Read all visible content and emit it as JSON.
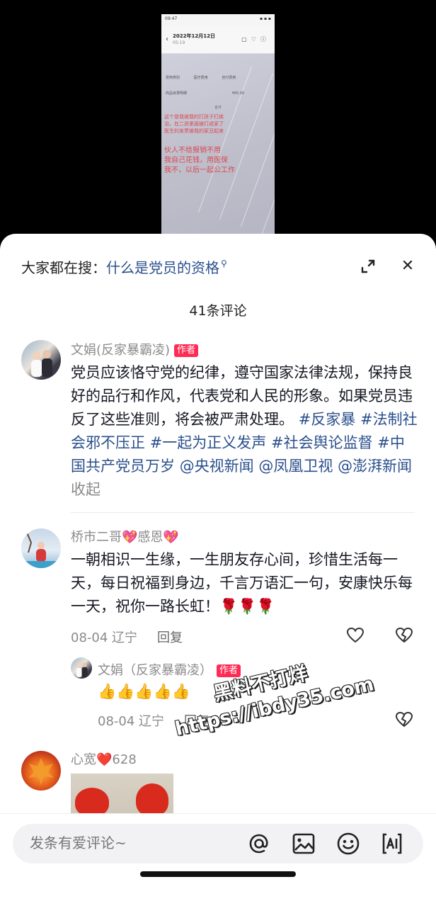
{
  "video": {
    "status_time": "09:47",
    "date": "2022年12月12日",
    "time": "05:19",
    "rows": [
      "费用类别",
      "医疗费用",
      "自付费用",
      "¥65.00",
      "商品目录明细",
      "合计"
    ],
    "red_lines": [
      "这个是我被我的打孩子打疾",
      "治，在二孩里面被打成家了",
      "医生的发票被我的家丑起来",
      "",
      "伙人不给报销不用",
      "我自己花钱，用医保",
      "我不，以后一起公工作"
    ]
  },
  "search": {
    "prefix": "大家都在搜：",
    "term": "什么是党员的资格"
  },
  "comments_count": "41条评论",
  "comments": [
    {
      "author": "文娟(反家暴霸凌)",
      "badge": "作者",
      "text": "党员应该恪守党的纪律，遵守国家法律法规，保持良好的品行和作风，代表党和人民的形象。如果党员违反了这些准则，将会被严肃处理。",
      "tags": [
        "#反家暴",
        "#法制社会邪不压正",
        "#一起为正义发声",
        "#社会舆论监督",
        "#中国共产党员万岁",
        "@央视新闻",
        "@凤凰卫视",
        "@澎湃新闻"
      ],
      "fold_label": "收起"
    },
    {
      "author": "桥市二哥💖感恩💖",
      "text": "一朝相识一生缘，一生朋友存心间，珍惜生活每一天，每日祝福到身边，千言万语汇一句，安康快乐每一天，祝你一路长虹！🌹🌹🌹",
      "date_location": "08-04 辽宁",
      "reply_label": "回复"
    },
    {
      "author": "文娟（反家暴霸凌）",
      "badge": "作者",
      "text": "👍👍👍👍👍",
      "date_location": "08-04 辽宁",
      "reply_label": "回复"
    },
    {
      "author": "心宽❤️628"
    }
  ],
  "watermark": {
    "line1": "黑料不打烊",
    "line2": "https://ibdy35.com"
  },
  "input": {
    "placeholder": "发条有爱评论~"
  },
  "icons": [
    "expand-icon",
    "close-icon",
    "heart-icon",
    "broken-heart-icon",
    "at-icon",
    "image-icon",
    "emoji-icon",
    "ai-icon"
  ]
}
